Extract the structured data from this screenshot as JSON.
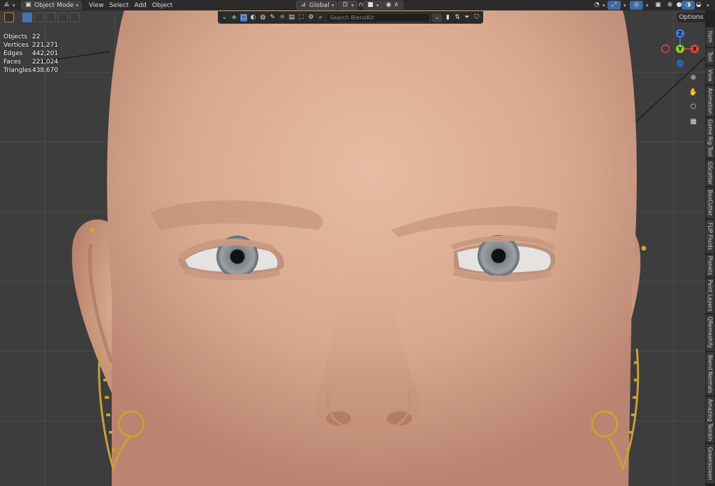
{
  "header": {
    "mode": "Object Mode",
    "menus": [
      "View",
      "Select",
      "Add",
      "Object"
    ],
    "orientation": "Global"
  },
  "stats": [
    {
      "label": "Objects",
      "value": "22"
    },
    {
      "label": "Vertices",
      "value": "221,271"
    },
    {
      "label": "Edges",
      "value": "442,201"
    },
    {
      "label": "Faces",
      "value": "221,024"
    },
    {
      "label": "Triangles",
      "value": "438,670"
    }
  ],
  "blenderkit": {
    "search_placeholder": "Search BlendKit"
  },
  "options_label": "Options",
  "gizmo": {
    "x": "X",
    "y": "Y",
    "z": "Z"
  },
  "side_tabs": [
    "Item",
    "Tool",
    "View",
    "Animation",
    "Game Rig Tool",
    "GScatter",
    "BoxCutter",
    "FLIP Fluids",
    "Planets",
    "Paint Layers",
    "QRemeshify",
    "Blend Normals",
    "Amazing Terrain",
    "Greenscreen"
  ],
  "colors": {
    "axis_x": "#e8413f",
    "axis_y": "#8fd11b",
    "axis_z": "#3f7ddb",
    "active": "#4772b3",
    "skin": "#d8a98f"
  }
}
